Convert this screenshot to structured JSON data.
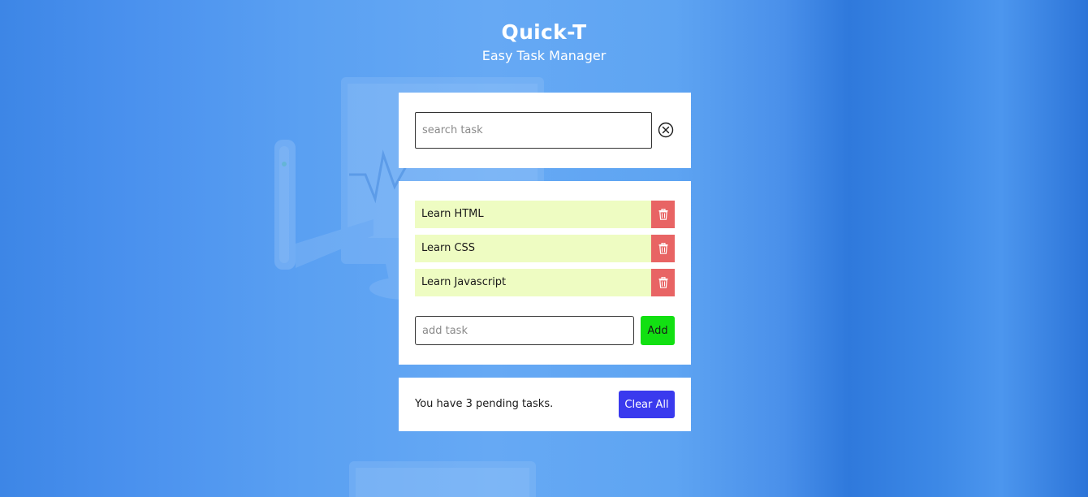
{
  "app": {
    "title": "Quick-T",
    "subtitle": "Easy Task Manager"
  },
  "search": {
    "placeholder": "search task",
    "value": "",
    "clear_icon": "close-circle-icon"
  },
  "tasks": [
    {
      "label": "Learn HTML",
      "delete_icon": "trash-icon"
    },
    {
      "label": "Learn CSS",
      "delete_icon": "trash-icon"
    },
    {
      "label": "Learn Javascript",
      "delete_icon": "trash-icon"
    }
  ],
  "add_task": {
    "placeholder": "add task",
    "value": "",
    "button_label": "Add"
  },
  "footer": {
    "pending_text": "You have 3 pending tasks.",
    "clear_all_label": "Clear All"
  },
  "colors": {
    "task_background": "#eefcc2",
    "delete_button": "#e86464",
    "add_button": "#12e012",
    "clear_all_button": "#3a3aee"
  }
}
